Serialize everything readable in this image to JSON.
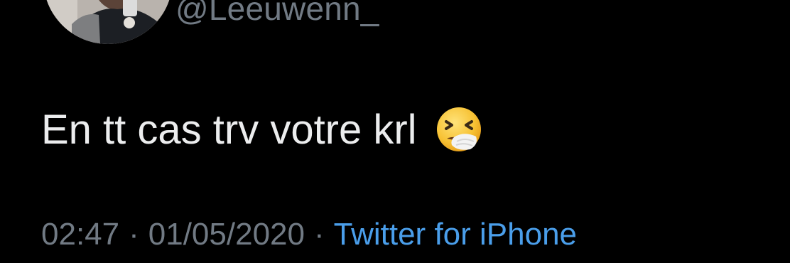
{
  "user": {
    "handle": "@Leeuwenn_"
  },
  "tweet": {
    "text": "En tt cas trv votre krl",
    "emoji_icon": "sneezing-face-icon"
  },
  "meta": {
    "time": "02:47",
    "separator": "·",
    "date": "01/05/2020",
    "source": "Twitter for iPhone"
  },
  "colors": {
    "background": "#000000",
    "text": "#ecedee",
    "secondary": "#717a84",
    "link": "#4a9eea"
  }
}
